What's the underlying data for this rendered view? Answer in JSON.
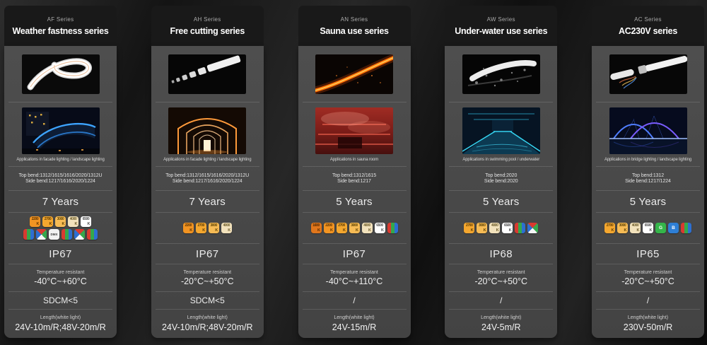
{
  "cct_unit": "K",
  "columns": [
    {
      "code": "AF Series",
      "title": "Weather fastness series",
      "image1_alt": "white LED neon flex strip bent in a loop",
      "image2_alt": "building facade outlined with blue neon lighting at night",
      "application": "Applications in facade lighting / landscape lighting",
      "top_bend": "Top bend:1312/1615/1616/2020/1312U",
      "side_bend": "Side bend:1217/1616/2020/1224",
      "warranty": "7 Years",
      "badge_rows": [
        [
          {
            "type": "cct",
            "label": "2200",
            "color": "#f29422",
            "text": "#5c3300"
          },
          {
            "type": "cct",
            "label": "2700",
            "color": "#f4a72f",
            "text": "#5c3a00"
          },
          {
            "type": "cct",
            "label": "3000",
            "color": "#f6bb55",
            "text": "#5e4200"
          },
          {
            "type": "cct",
            "label": "4000",
            "color": "#f2e2bc",
            "text": "#6b5a28"
          },
          {
            "type": "cct",
            "label": "6500",
            "color": "#ffffff",
            "text": "#4e4e4e"
          }
        ],
        [
          {
            "type": "rgb"
          },
          {
            "type": "rgbw"
          },
          {
            "type": "dmx",
            "label": "DMX"
          },
          {
            "type": "rgb"
          },
          {
            "type": "rgbw"
          },
          {
            "type": "rgb"
          }
        ]
      ],
      "ip": "IP67",
      "temp_label": "Temperature resistant",
      "temp_value": "-40°C~+60°C",
      "sdcm": "SDCM<5",
      "length_label": "Length(white light)",
      "length_value": "24V-10m/R;48V-20m/R"
    },
    {
      "code": "AH Series",
      "title": "Free cutting series",
      "image1_alt": "white LED strip cut into free-length pieces",
      "image2_alt": "arched corridor with warm orange lighting",
      "application": "Applications in facade lighting / landscape lighting",
      "top_bend": "Top bend:1312/1615/1616/2020/1312U",
      "side_bend": "Side bend:1217/1616/2020/1224",
      "warranty": "7 Years",
      "badge_rows": [
        [
          {
            "type": "cct",
            "label": "2200",
            "color": "#f29422",
            "text": "#5c3300"
          },
          {
            "type": "cct",
            "label": "2700",
            "color": "#f4a72f",
            "text": "#5c3a00"
          },
          {
            "type": "cct",
            "label": "3000",
            "color": "#f6bb55",
            "text": "#5e4200"
          },
          {
            "type": "cct",
            "label": "4000",
            "color": "#f2e2bc",
            "text": "#6b5a28"
          }
        ]
      ],
      "ip": "IP67",
      "temp_label": "Temperature resistant",
      "temp_value": "-20°C~+50°C",
      "sdcm": "SDCM<5",
      "length_label": "Length(white light)",
      "length_value": "24V-10m/R;48V-20m/R"
    },
    {
      "code": "AN Series",
      "title": "Sauna use series",
      "image1_alt": "glowing orange LED neon strip with sparks",
      "image2_alt": "sauna room lit with red LED light and steam",
      "application": "Applications in sauna room",
      "top_bend": "Top bend:1312/1615",
      "side_bend": "Side bend:1217",
      "warranty": "5 Years",
      "badge_rows": [
        [
          {
            "type": "cct",
            "label": "1600",
            "color": "#e0761c",
            "text": "#542a00"
          },
          {
            "type": "cct",
            "label": "2200",
            "color": "#f29422",
            "text": "#5c3300"
          },
          {
            "type": "cct",
            "label": "2700",
            "color": "#f4a72f",
            "text": "#5c3a00"
          },
          {
            "type": "cct",
            "label": "3000",
            "color": "#f6bb55",
            "text": "#5e4200"
          },
          {
            "type": "cct",
            "label": "4000",
            "color": "#f2e2bc",
            "text": "#6b5a28"
          },
          {
            "type": "cct",
            "label": "6500",
            "color": "#ffffff",
            "text": "#4e4e4e"
          },
          {
            "type": "rgb"
          }
        ]
      ],
      "ip": "IP67",
      "temp_label": "Temperature resistant",
      "temp_value": "-40°C~+110°C",
      "sdcm": "/",
      "length_label": "Length(white light)",
      "length_value": "24V-15m/R"
    },
    {
      "code": "AW Series",
      "title": "Under-water use series",
      "image1_alt": "white LED neon strip splashing through water",
      "image2_alt": "indoor swimming pool with cyan underwater lighting",
      "application": "Applications in  swimming pool / underwater",
      "top_bend": "Top bend:2020",
      "side_bend": "Side bend:2020",
      "warranty": "5 Years",
      "badge_rows": [
        [
          {
            "type": "cct",
            "label": "2700",
            "color": "#f4a72f",
            "text": "#5c3a00"
          },
          {
            "type": "cct",
            "label": "3000",
            "color": "#f6bb55",
            "text": "#5e4200"
          },
          {
            "type": "cct",
            "label": "4000",
            "color": "#f2e2bc",
            "text": "#6b5a28"
          },
          {
            "type": "cct",
            "label": "6500",
            "color": "#ffffff",
            "text": "#4e4e4e"
          },
          {
            "type": "rgb"
          },
          {
            "type": "rgbw"
          }
        ]
      ],
      "ip": "IP68",
      "temp_label": "Temperature resistant",
      "temp_value": "-20°C~+50°C",
      "sdcm": "/",
      "length_label": "Length(white light)",
      "length_value": "24V-5m/R"
    },
    {
      "code": "AC Series",
      "title": "AC230V series",
      "image1_alt": "white LED neon strips with power connector and wires",
      "image2_alt": "bridge arches outlined with blue lighting at night",
      "application": "Applications in bridge lighting / landscape lighting",
      "top_bend": "Top bend:1312",
      "side_bend": "Side bend:1217/1224",
      "warranty": "5 Years",
      "badge_rows": [
        [
          {
            "type": "cct",
            "label": "2700",
            "color": "#f4a72f",
            "text": "#5c3a00"
          },
          {
            "type": "cct",
            "label": "3000",
            "color": "#f6bb55",
            "text": "#5e4200"
          },
          {
            "type": "cct",
            "label": "4000",
            "color": "#f2e2bc",
            "text": "#6b5a28"
          },
          {
            "type": "cct",
            "label": "6500",
            "color": "#ffffff",
            "text": "#4e4e4e"
          },
          {
            "type": "solid",
            "label": "G",
            "color": "#35b54a"
          },
          {
            "type": "solid",
            "label": "B",
            "color": "#2e7fd6"
          },
          {
            "type": "rgb"
          }
        ]
      ],
      "ip": "IP65",
      "temp_label": "Temperature resistant",
      "temp_value": "-20°C~+50°C",
      "sdcm": "/",
      "length_label": "Length(white light)",
      "length_value": "230V-50m/R"
    }
  ]
}
